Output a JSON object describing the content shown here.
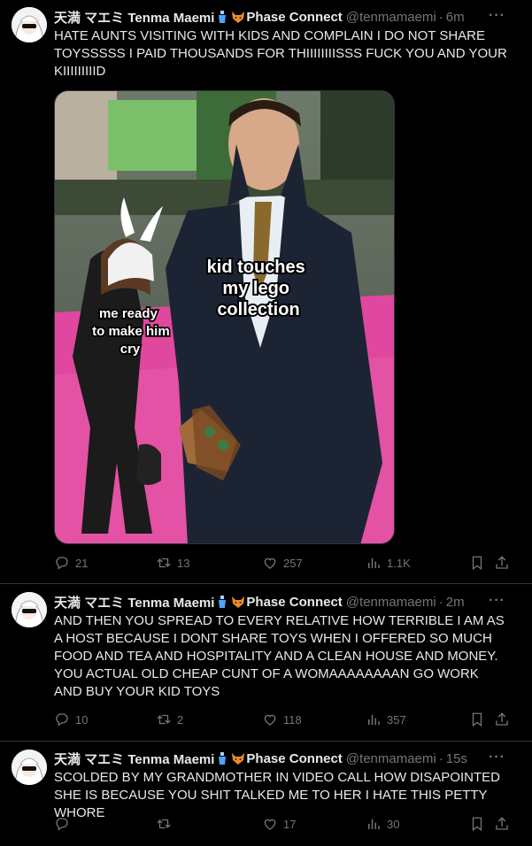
{
  "tweets": [
    {
      "display_name": "天満 マエミ Tenma Maemi",
      "affiliation": "Phase Connect",
      "handle": "@tenmamaemi",
      "time": "6m",
      "text": "HATE AUNTS VISITING WITH KIDS AND COMPLAIN I DO NOT SHARE TOYSSSSS I PAID THOUSANDS FOR THIIIIIIIISSS  FUCK YOU AND YOUR KIIIIIIIIID",
      "image": {
        "caption_1": "kid touches my lego collection",
        "caption_2": "me ready to make him cry"
      },
      "replies": "21",
      "retweets": "13",
      "likes": "257",
      "views": "1.1K"
    },
    {
      "display_name": "天満 マエミ Tenma Maemi",
      "affiliation": "Phase Connect",
      "handle": "@tenmamaemi",
      "time": "2m",
      "text": "AND THEN YOU SPREAD TO EVERY RELATIVE HOW TERRIBLE I AM AS A HOST BECAUSE I DONT SHARE TOYS WHEN I OFFERED SO MUCH FOOD AND TEA AND HOSPITALITY AND A CLEAN HOUSE AND MONEY. YOU ACTUAL OLD CHEAP CUNT OF A WOMAAAAAAAAN GO WORK AND BUY YOUR KID TOYS",
      "replies": "10",
      "retweets": "2",
      "likes": "118",
      "views": "357"
    },
    {
      "display_name": "天満 マエミ Tenma Maemi",
      "affiliation": "Phase Connect",
      "handle": "@tenmamaemi",
      "time": "15s",
      "text": "SCOLDED BY MY GRANDMOTHER IN VIDEO CALL HOW DISAPOINTED SHE IS BECAUSE YOU SHIT TALKED ME TO HER  I HATE THIS PETTY WHORE",
      "replies": "",
      "retweets": "",
      "likes": "17",
      "views": "30"
    }
  ],
  "colors": {
    "background": "#000000",
    "text": "#e7e9ea",
    "muted": "#71767b",
    "divider": "#2f3336",
    "carpet": "#e0479e"
  },
  "icons": [
    "avatar",
    "bottle-icon",
    "fox-icon",
    "more-icon",
    "reply-icon",
    "retweet-icon",
    "like-icon",
    "views-icon",
    "bookmark-icon",
    "share-icon"
  ]
}
